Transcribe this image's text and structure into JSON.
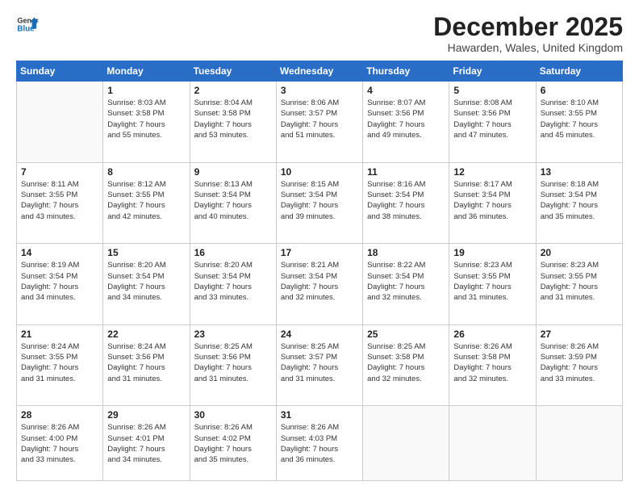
{
  "header": {
    "logo_line1": "General",
    "logo_line2": "Blue",
    "month": "December 2025",
    "location": "Hawarden, Wales, United Kingdom"
  },
  "weekdays": [
    "Sunday",
    "Monday",
    "Tuesday",
    "Wednesday",
    "Thursday",
    "Friday",
    "Saturday"
  ],
  "weeks": [
    [
      {
        "day": "",
        "info": ""
      },
      {
        "day": "1",
        "info": "Sunrise: 8:03 AM\nSunset: 3:58 PM\nDaylight: 7 hours\nand 55 minutes."
      },
      {
        "day": "2",
        "info": "Sunrise: 8:04 AM\nSunset: 3:58 PM\nDaylight: 7 hours\nand 53 minutes."
      },
      {
        "day": "3",
        "info": "Sunrise: 8:06 AM\nSunset: 3:57 PM\nDaylight: 7 hours\nand 51 minutes."
      },
      {
        "day": "4",
        "info": "Sunrise: 8:07 AM\nSunset: 3:56 PM\nDaylight: 7 hours\nand 49 minutes."
      },
      {
        "day": "5",
        "info": "Sunrise: 8:08 AM\nSunset: 3:56 PM\nDaylight: 7 hours\nand 47 minutes."
      },
      {
        "day": "6",
        "info": "Sunrise: 8:10 AM\nSunset: 3:55 PM\nDaylight: 7 hours\nand 45 minutes."
      }
    ],
    [
      {
        "day": "7",
        "info": "Sunrise: 8:11 AM\nSunset: 3:55 PM\nDaylight: 7 hours\nand 43 minutes."
      },
      {
        "day": "8",
        "info": "Sunrise: 8:12 AM\nSunset: 3:55 PM\nDaylight: 7 hours\nand 42 minutes."
      },
      {
        "day": "9",
        "info": "Sunrise: 8:13 AM\nSunset: 3:54 PM\nDaylight: 7 hours\nand 40 minutes."
      },
      {
        "day": "10",
        "info": "Sunrise: 8:15 AM\nSunset: 3:54 PM\nDaylight: 7 hours\nand 39 minutes."
      },
      {
        "day": "11",
        "info": "Sunrise: 8:16 AM\nSunset: 3:54 PM\nDaylight: 7 hours\nand 38 minutes."
      },
      {
        "day": "12",
        "info": "Sunrise: 8:17 AM\nSunset: 3:54 PM\nDaylight: 7 hours\nand 36 minutes."
      },
      {
        "day": "13",
        "info": "Sunrise: 8:18 AM\nSunset: 3:54 PM\nDaylight: 7 hours\nand 35 minutes."
      }
    ],
    [
      {
        "day": "14",
        "info": "Sunrise: 8:19 AM\nSunset: 3:54 PM\nDaylight: 7 hours\nand 34 minutes."
      },
      {
        "day": "15",
        "info": "Sunrise: 8:20 AM\nSunset: 3:54 PM\nDaylight: 7 hours\nand 34 minutes."
      },
      {
        "day": "16",
        "info": "Sunrise: 8:20 AM\nSunset: 3:54 PM\nDaylight: 7 hours\nand 33 minutes."
      },
      {
        "day": "17",
        "info": "Sunrise: 8:21 AM\nSunset: 3:54 PM\nDaylight: 7 hours\nand 32 minutes."
      },
      {
        "day": "18",
        "info": "Sunrise: 8:22 AM\nSunset: 3:54 PM\nDaylight: 7 hours\nand 32 minutes."
      },
      {
        "day": "19",
        "info": "Sunrise: 8:23 AM\nSunset: 3:55 PM\nDaylight: 7 hours\nand 31 minutes."
      },
      {
        "day": "20",
        "info": "Sunrise: 8:23 AM\nSunset: 3:55 PM\nDaylight: 7 hours\nand 31 minutes."
      }
    ],
    [
      {
        "day": "21",
        "info": "Sunrise: 8:24 AM\nSunset: 3:55 PM\nDaylight: 7 hours\nand 31 minutes."
      },
      {
        "day": "22",
        "info": "Sunrise: 8:24 AM\nSunset: 3:56 PM\nDaylight: 7 hours\nand 31 minutes."
      },
      {
        "day": "23",
        "info": "Sunrise: 8:25 AM\nSunset: 3:56 PM\nDaylight: 7 hours\nand 31 minutes."
      },
      {
        "day": "24",
        "info": "Sunrise: 8:25 AM\nSunset: 3:57 PM\nDaylight: 7 hours\nand 31 minutes."
      },
      {
        "day": "25",
        "info": "Sunrise: 8:25 AM\nSunset: 3:58 PM\nDaylight: 7 hours\nand 32 minutes."
      },
      {
        "day": "26",
        "info": "Sunrise: 8:26 AM\nSunset: 3:58 PM\nDaylight: 7 hours\nand 32 minutes."
      },
      {
        "day": "27",
        "info": "Sunrise: 8:26 AM\nSunset: 3:59 PM\nDaylight: 7 hours\nand 33 minutes."
      }
    ],
    [
      {
        "day": "28",
        "info": "Sunrise: 8:26 AM\nSunset: 4:00 PM\nDaylight: 7 hours\nand 33 minutes."
      },
      {
        "day": "29",
        "info": "Sunrise: 8:26 AM\nSunset: 4:01 PM\nDaylight: 7 hours\nand 34 minutes."
      },
      {
        "day": "30",
        "info": "Sunrise: 8:26 AM\nSunset: 4:02 PM\nDaylight: 7 hours\nand 35 minutes."
      },
      {
        "day": "31",
        "info": "Sunrise: 8:26 AM\nSunset: 4:03 PM\nDaylight: 7 hours\nand 36 minutes."
      },
      {
        "day": "",
        "info": ""
      },
      {
        "day": "",
        "info": ""
      },
      {
        "day": "",
        "info": ""
      }
    ]
  ]
}
